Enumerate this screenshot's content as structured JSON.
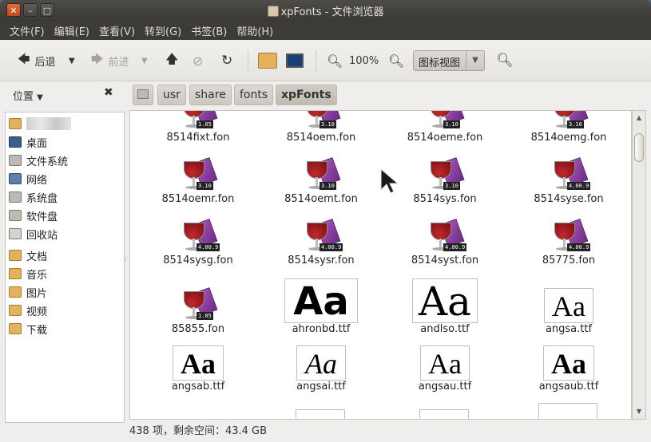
{
  "window": {
    "title": "xpFonts - 文件浏览器",
    "buttons": [
      "✕",
      "–",
      "□"
    ]
  },
  "menu": [
    "文件(F)",
    "编辑(E)",
    "查看(V)",
    "转到(G)",
    "书签(B)",
    "帮助(H)"
  ],
  "toolbar": {
    "back_label": "后退",
    "forward_label": "前进",
    "zoom_level": "100%",
    "view_mode": "图标视图"
  },
  "sidebar": {
    "header": "位置",
    "items": [
      {
        "label": "",
        "icon": "home-folder-icon",
        "type": "home"
      },
      {
        "label": "桌面",
        "icon": "desktop-icon",
        "type": "desk"
      },
      {
        "label": "文件系统",
        "icon": "filesystem-icon",
        "type": "fs"
      },
      {
        "label": "网络",
        "icon": "network-icon",
        "type": "net"
      },
      {
        "label": "系统盘",
        "icon": "drive-icon",
        "type": "fs"
      },
      {
        "label": "软件盘",
        "icon": "drive-icon",
        "type": "fs"
      },
      {
        "label": "回收站",
        "icon": "trash-icon",
        "type": "trash"
      },
      {
        "label": "文档",
        "icon": "folder-icon",
        "type": "folder"
      },
      {
        "label": "音乐",
        "icon": "folder-icon",
        "type": "folder"
      },
      {
        "label": "图片",
        "icon": "folder-icon",
        "type": "folder"
      },
      {
        "label": "视频",
        "icon": "folder-icon",
        "type": "folder"
      },
      {
        "label": "下载",
        "icon": "folder-icon",
        "type": "folder"
      }
    ]
  },
  "path": [
    "usr",
    "share",
    "fonts",
    "xpFonts"
  ],
  "files": [
    {
      "name": "8514fixt.fon",
      "icon": "wine",
      "ver": "1.05"
    },
    {
      "name": "8514oem.fon",
      "icon": "wine",
      "ver": "3.10"
    },
    {
      "name": "8514oeme.fon",
      "icon": "wine",
      "ver": "3.10"
    },
    {
      "name": "8514oemg.fon",
      "icon": "wine",
      "ver": "3.10"
    },
    {
      "name": "8514oemr.fon",
      "icon": "wine",
      "ver": "3.10"
    },
    {
      "name": "8514oemt.fon",
      "icon": "wine",
      "ver": "3.10"
    },
    {
      "name": "8514sys.fon",
      "icon": "wine",
      "ver": "3.10"
    },
    {
      "name": "8514syse.fon",
      "icon": "wine",
      "ver": "4.00.9"
    },
    {
      "name": "8514sysg.fon",
      "icon": "wine",
      "ver": "4.00.9"
    },
    {
      "name": "8514sysr.fon",
      "icon": "wine",
      "ver": "4.00.9"
    },
    {
      "name": "8514syst.fon",
      "icon": "wine",
      "ver": "4.00.9"
    },
    {
      "name": "85775.fon",
      "icon": "wine",
      "ver": "4.00.9"
    },
    {
      "name": "85855.fon",
      "icon": "wine",
      "ver": "1.05"
    },
    {
      "name": "ahronbd.ttf",
      "icon": "aa",
      "sample": "Aa"
    },
    {
      "name": "andlso.ttf",
      "icon": "aa",
      "sample": "Aa"
    },
    {
      "name": "angsa.ttf",
      "icon": "aa",
      "sample": "Aa"
    },
    {
      "name": "angsab.ttf",
      "icon": "aa",
      "sample": "Aa"
    },
    {
      "name": "angsai.ttf",
      "icon": "aa",
      "sample": "Aa"
    },
    {
      "name": "angsau.ttf",
      "icon": "aa",
      "sample": "Aa"
    },
    {
      "name": "angsaub.ttf",
      "icon": "aa",
      "sample": "Aa"
    }
  ],
  "status": "438 项，剩余空间：43.4 GB"
}
